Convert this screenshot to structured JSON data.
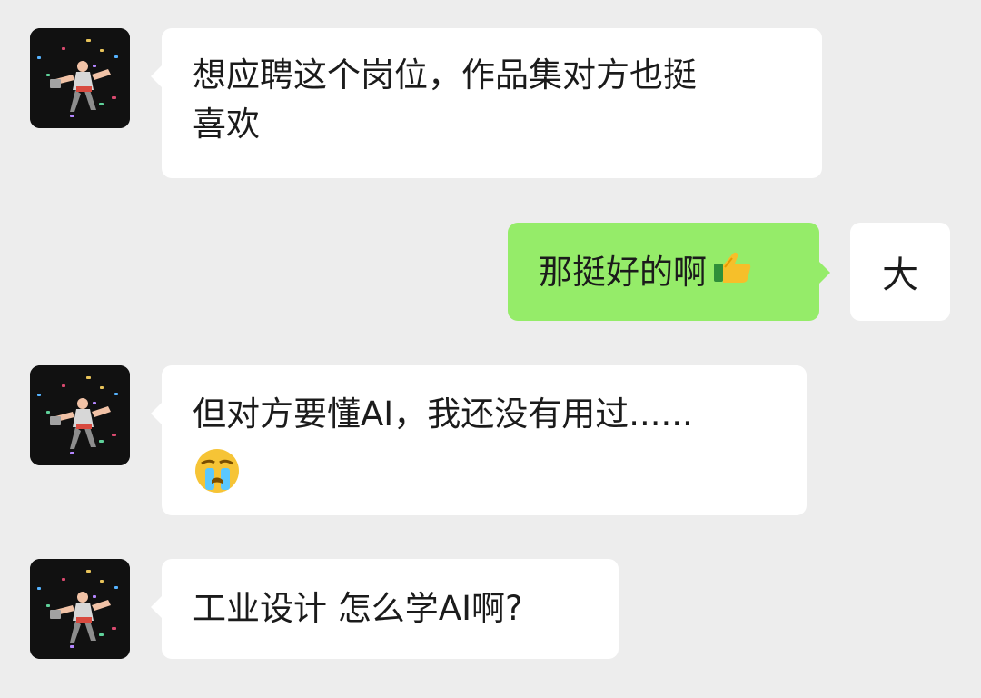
{
  "messages": [
    {
      "side": "left",
      "lines": [
        "想应聘这个岗位，作品集对方也挺",
        "喜欢"
      ]
    },
    {
      "side": "right",
      "text": "那挺好的啊",
      "emoji_icon": "thumbs-up-icon"
    },
    {
      "side": "left",
      "text": "但对方要懂AI，我还没有用过......",
      "emoji_icon": "crying-face-icon"
    },
    {
      "side": "left",
      "text": "工业设计 怎么学AI啊?"
    }
  ],
  "right_avatar_text": "大",
  "colors": {
    "background": "#ededed",
    "incoming_bubble": "#ffffff",
    "outgoing_bubble": "#95ec69",
    "text": "#1b1b1b",
    "avatar_background": "#101010"
  }
}
